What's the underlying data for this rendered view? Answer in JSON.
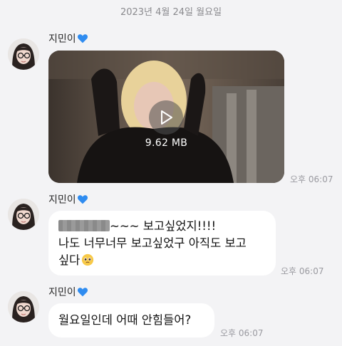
{
  "date_header": "2023년 4월 24일 월요일",
  "messages": [
    {
      "sender": "지민이",
      "type": "video",
      "video_size": "9.62 MB",
      "time": "오후 06:07"
    },
    {
      "sender": "지민이",
      "type": "text",
      "line1_suffix": "~~~ 보고싶었지!!!!",
      "line2": "나도 너무너무 보고싶었구 아직도 보고",
      "line3": "싶다",
      "time": "오후 06:07"
    },
    {
      "sender": "지민이",
      "type": "text",
      "text": "월요일인데 어때 안힘들어?",
      "time": "오후 06:07"
    }
  ],
  "colors": {
    "background": "#f3f3f5",
    "bubble": "#ffffff",
    "heart": "#2f8cf0",
    "time": "#9a9aa0"
  },
  "icons": [
    "blue-heart-icon",
    "play-icon",
    "pleading-face-emoji"
  ]
}
